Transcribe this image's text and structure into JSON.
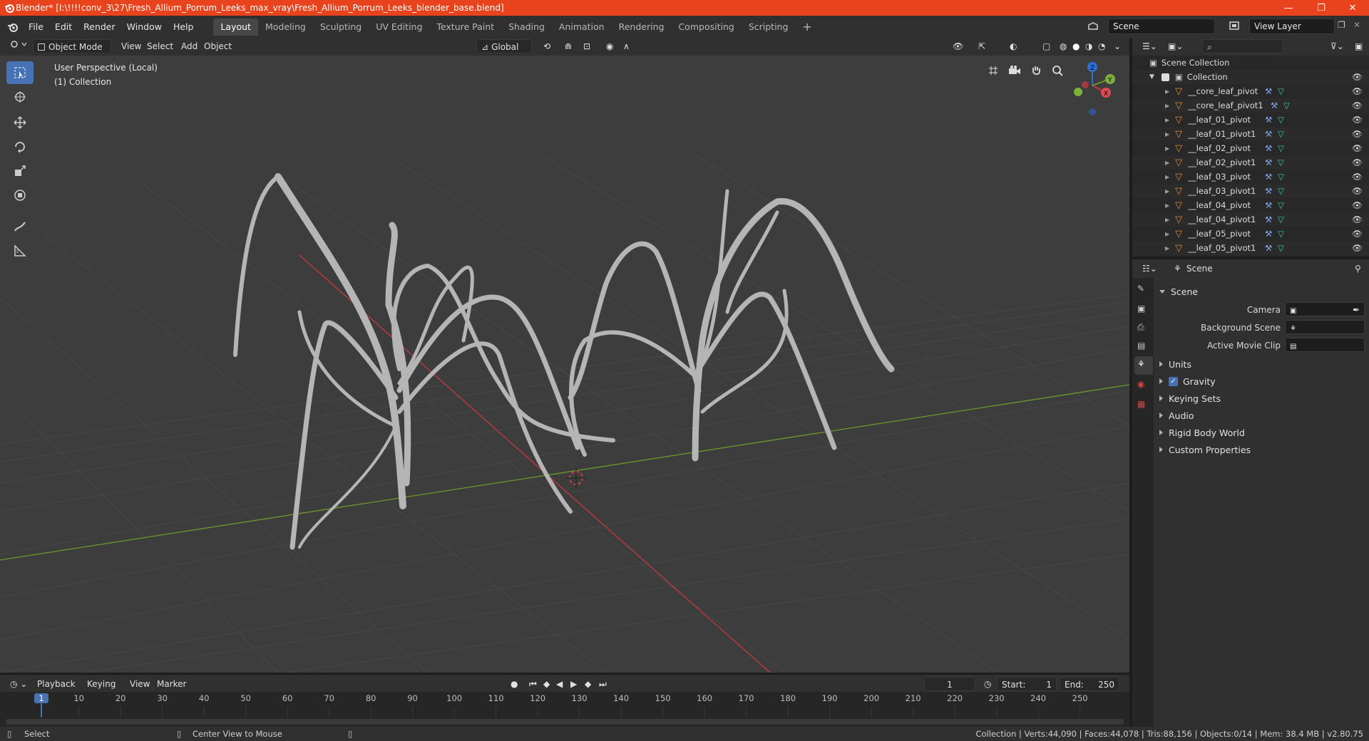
{
  "titlebar": {
    "title": "Blender* [I:\\!!!!conv_3\\27\\Fresh_Allium_Porrum_Leeks_max_vray\\Fresh_Allium_Porrum_Leeks_blender_base.blend]",
    "minimize": "—",
    "restore": "❐",
    "close": "✕",
    "bg_color": "#e8431c"
  },
  "menu": [
    "File",
    "Edit",
    "Render",
    "Window",
    "Help"
  ],
  "workspaces": {
    "tabs": [
      "Layout",
      "Modeling",
      "Sculpting",
      "UV Editing",
      "Texture Paint",
      "Shading",
      "Animation",
      "Rendering",
      "Compositing",
      "Scripting"
    ],
    "active": "Layout",
    "add": "+"
  },
  "scene_selector": {
    "value": "Scene"
  },
  "view_layer_selector": {
    "value": "View Layer"
  },
  "viewport_header": {
    "mode": "Object Mode",
    "menus": [
      "View",
      "Select",
      "Add",
      "Object"
    ],
    "orientation": "Global"
  },
  "viewport": {
    "perspective_label": "User Perspective (Local)",
    "collection_label": "(1) Collection",
    "axis_x_color": "#c8383f",
    "axis_y_color": "#6b9a2a",
    "gizmo": {
      "z": "Z",
      "y": "Y",
      "x": "X"
    }
  },
  "outliner": {
    "root": "Scene Collection",
    "collection": "Collection",
    "items": [
      "__core_leaf_pivot",
      "__core_leaf_pivot1",
      "__leaf_01_pivot",
      "__leaf_01_pivot1",
      "__leaf_02_pivot",
      "__leaf_02_pivot1",
      "__leaf_03_pivot",
      "__leaf_03_pivot1",
      "__leaf_04_pivot",
      "__leaf_04_pivot1",
      "__leaf_05_pivot",
      "__leaf_05_pivot1"
    ]
  },
  "properties": {
    "header": "Scene",
    "section": "Scene",
    "camera_label": "Camera",
    "background_scene_label": "Background Scene",
    "active_movie_clip_label": "Active Movie Clip",
    "panels": [
      "Units",
      "Gravity",
      "Keying Sets",
      "Audio",
      "Rigid Body World",
      "Custom Properties"
    ],
    "gravity_checked": true
  },
  "timeline": {
    "menus": [
      "Playback",
      "Keying",
      "View",
      "Marker"
    ],
    "current_frame": "1",
    "start_label": "Start:",
    "start": "1",
    "end_label": "End:",
    "end": "250",
    "ticks": [
      "1",
      "10",
      "20",
      "30",
      "40",
      "50",
      "60",
      "70",
      "80",
      "90",
      "100",
      "110",
      "120",
      "130",
      "140",
      "150",
      "160",
      "170",
      "180",
      "190",
      "200",
      "210",
      "220",
      "230",
      "240",
      "250"
    ]
  },
  "statusbar": {
    "left_action": "Select",
    "middle_action": "Center View to Mouse",
    "stats": "Collection | Verts:44,090 | Faces:44,078 | Tris:88,156 | Objects:0/14 | Mem: 38.4 MB | v2.80.75"
  }
}
